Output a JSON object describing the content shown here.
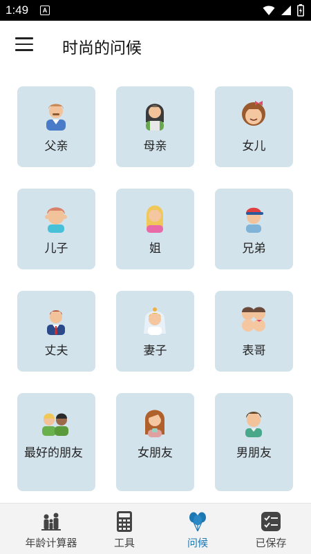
{
  "status_bar": {
    "time": "1:49",
    "app_icon_letter": "A"
  },
  "header": {
    "title": "时尚的问候"
  },
  "cards": [
    {
      "label": "父亲",
      "icon": "father-icon"
    },
    {
      "label": "母亲",
      "icon": "mother-icon"
    },
    {
      "label": "女儿",
      "icon": "daughter-icon"
    },
    {
      "label": "儿子",
      "icon": "son-icon"
    },
    {
      "label": "姐",
      "icon": "sister-icon"
    },
    {
      "label": "兄弟",
      "icon": "brother-icon"
    },
    {
      "label": "丈夫",
      "icon": "husband-icon"
    },
    {
      "label": "妻子",
      "icon": "wife-icon"
    },
    {
      "label": "表哥",
      "icon": "cousin-icon"
    },
    {
      "label": "最好的朋友",
      "icon": "best-friends-icon"
    },
    {
      "label": "女朋友",
      "icon": "girlfriend-icon"
    },
    {
      "label": "男朋友",
      "icon": "boyfriend-icon"
    }
  ],
  "bottom_nav": [
    {
      "label": "年龄计算器",
      "icon": "family-icon",
      "active": false
    },
    {
      "label": "工具",
      "icon": "calculator-icon",
      "active": false
    },
    {
      "label": "问候",
      "icon": "balloons-icon",
      "active": true
    },
    {
      "label": "已保存",
      "icon": "checklist-icon",
      "active": false
    }
  ],
  "colors": {
    "card_bg": "#d3e3ec",
    "active_nav": "#1d77b3"
  }
}
